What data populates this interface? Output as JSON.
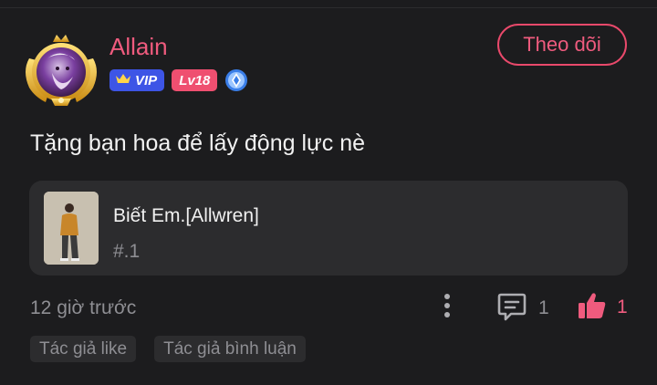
{
  "post": {
    "username": "Allain",
    "vip_label": "VIP",
    "level_label": "Lv18",
    "follow_label": "Theo dõi",
    "comment": "Tặng bạn hoa để lấy động lực nè",
    "song": {
      "title": "Biết Em.[Allwren]",
      "rank": "#.1"
    },
    "timestamp": "12 giờ trước",
    "comment_count": "1",
    "like_count": "1",
    "tags": [
      "Tác giả like",
      "Tác giả bình luận"
    ]
  },
  "colors": {
    "background": "#1c1c1e",
    "accent": "#ef5b7e",
    "vip_blue": "#3d55e6",
    "level_pink": "#ef4f70",
    "card": "#2c2c2e",
    "muted_text": "#8e8e93"
  },
  "icons": [
    "crown-icon",
    "shield-badge-icon",
    "more-vertical-icon",
    "comment-icon",
    "thumbs-up-icon"
  ]
}
